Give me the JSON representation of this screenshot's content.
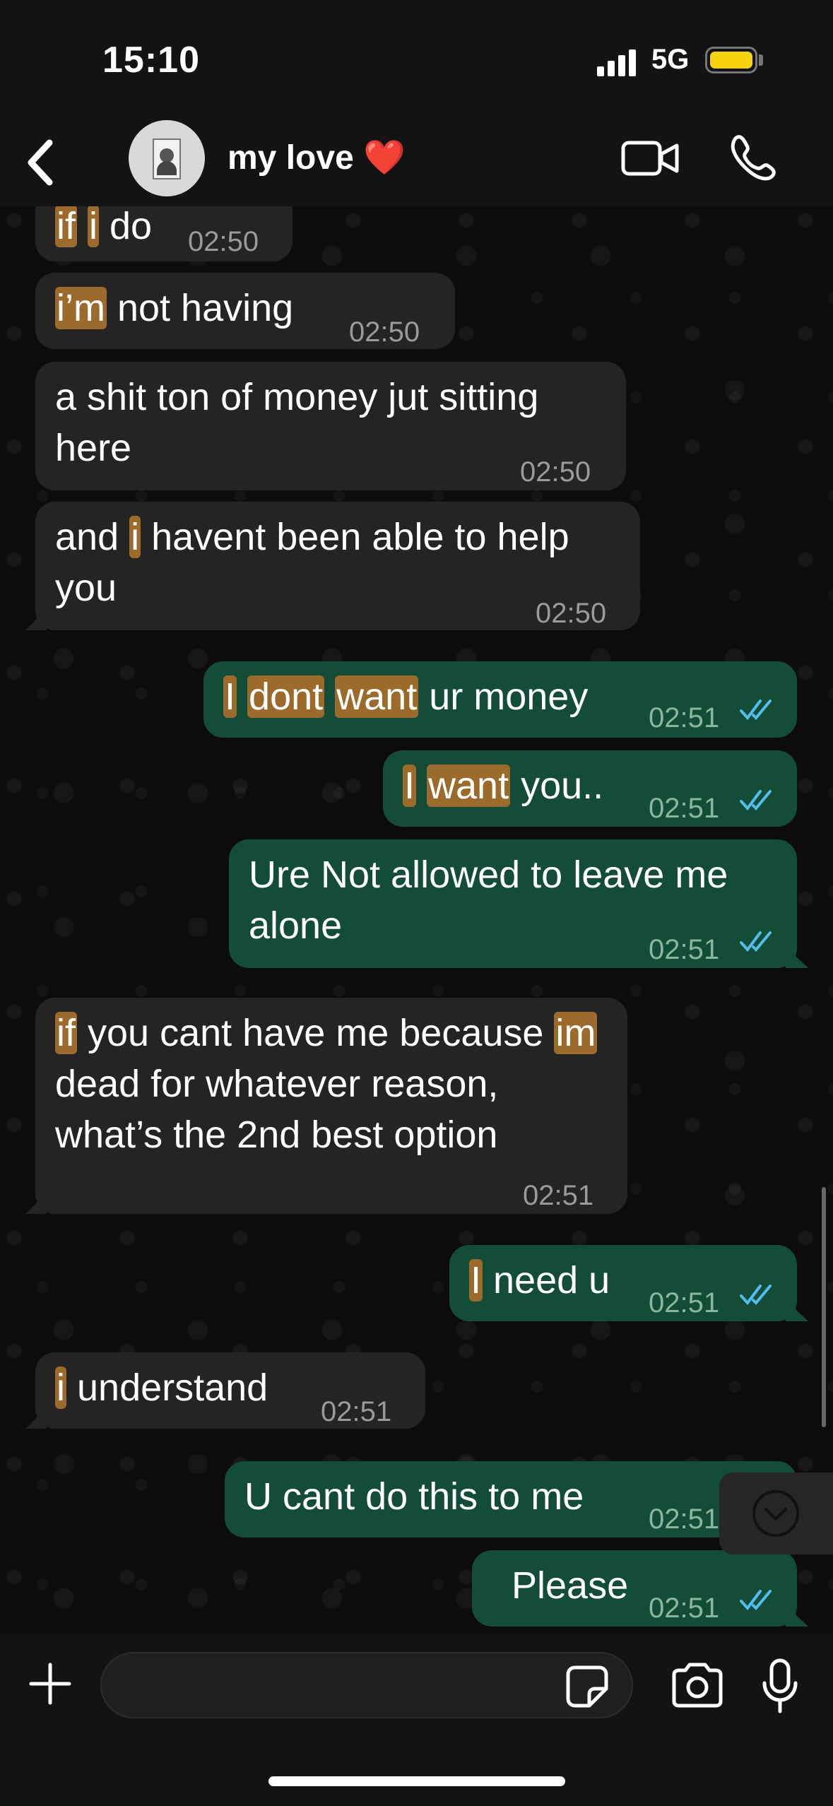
{
  "status_bar": {
    "time": "15:10",
    "network": "5G",
    "battery_color": "#f5d40f"
  },
  "header": {
    "contact_name": "my love ❤️",
    "back_icon": "chevron-left-icon",
    "video_icon": "video-camera-icon",
    "call_icon": "phone-icon"
  },
  "colors": {
    "incoming_bubble": "#242424",
    "outgoing_bubble": "#144d37",
    "search_highlight": "#9c6a2b",
    "read_ticks": "#53bdeb"
  },
  "messages": [
    {
      "direction": "in",
      "parts": [
        {
          "t": "if",
          "hl": true
        },
        {
          "t": " "
        },
        {
          "t": "i",
          "hl": true
        },
        {
          "t": " do"
        }
      ],
      "time": "02:50"
    },
    {
      "direction": "in",
      "parts": [
        {
          "t": "i’m",
          "hl": true
        },
        {
          "t": " not having"
        }
      ],
      "time": "02:50"
    },
    {
      "direction": "in",
      "parts": [
        {
          "t": "a shit ton of money jut sitting here"
        }
      ],
      "time": "02:50"
    },
    {
      "direction": "in",
      "parts": [
        {
          "t": "and "
        },
        {
          "t": "i",
          "hl": true
        },
        {
          "t": " havent been able to help you"
        }
      ],
      "time": "02:50"
    },
    {
      "direction": "out",
      "parts": [
        {
          "t": "I",
          "hl": true
        },
        {
          "t": " "
        },
        {
          "t": "dont",
          "hl": true
        },
        {
          "t": " "
        },
        {
          "t": "want",
          "hl": true
        },
        {
          "t": " ur money"
        }
      ],
      "time": "02:51",
      "read": true
    },
    {
      "direction": "out",
      "parts": [
        {
          "t": "I",
          "hl": true
        },
        {
          "t": " "
        },
        {
          "t": "want",
          "hl": true
        },
        {
          "t": " you.."
        }
      ],
      "time": "02:51",
      "read": true
    },
    {
      "direction": "out",
      "parts": [
        {
          "t": "Ure Not allowed to leave me alone"
        }
      ],
      "time": "02:51",
      "read": true
    },
    {
      "direction": "in",
      "parts": [
        {
          "t": "if",
          "hl": true
        },
        {
          "t": " you cant have me because "
        },
        {
          "t": "im",
          "hl": true
        },
        {
          "t": " dead for whatever reason, what’s the 2nd best option"
        }
      ],
      "time": "02:51"
    },
    {
      "direction": "out",
      "parts": [
        {
          "t": "I",
          "hl": true
        },
        {
          "t": " need u"
        }
      ],
      "time": "02:51",
      "read": true
    },
    {
      "direction": "in",
      "parts": [
        {
          "t": "i",
          "hl": true
        },
        {
          "t": " understand"
        }
      ],
      "time": "02:51"
    },
    {
      "direction": "out",
      "parts": [
        {
          "t": "U cant do this to me"
        }
      ],
      "time": "02:51",
      "read": true
    },
    {
      "direction": "out",
      "parts": [
        {
          "t": "Please"
        }
      ],
      "time": "02:51",
      "read": true
    }
  ],
  "input_bar": {
    "placeholder": "",
    "plus_icon": "plus-icon",
    "sticker_icon": "sticker-icon",
    "camera_icon": "camera-icon",
    "mic_icon": "microphone-icon"
  }
}
